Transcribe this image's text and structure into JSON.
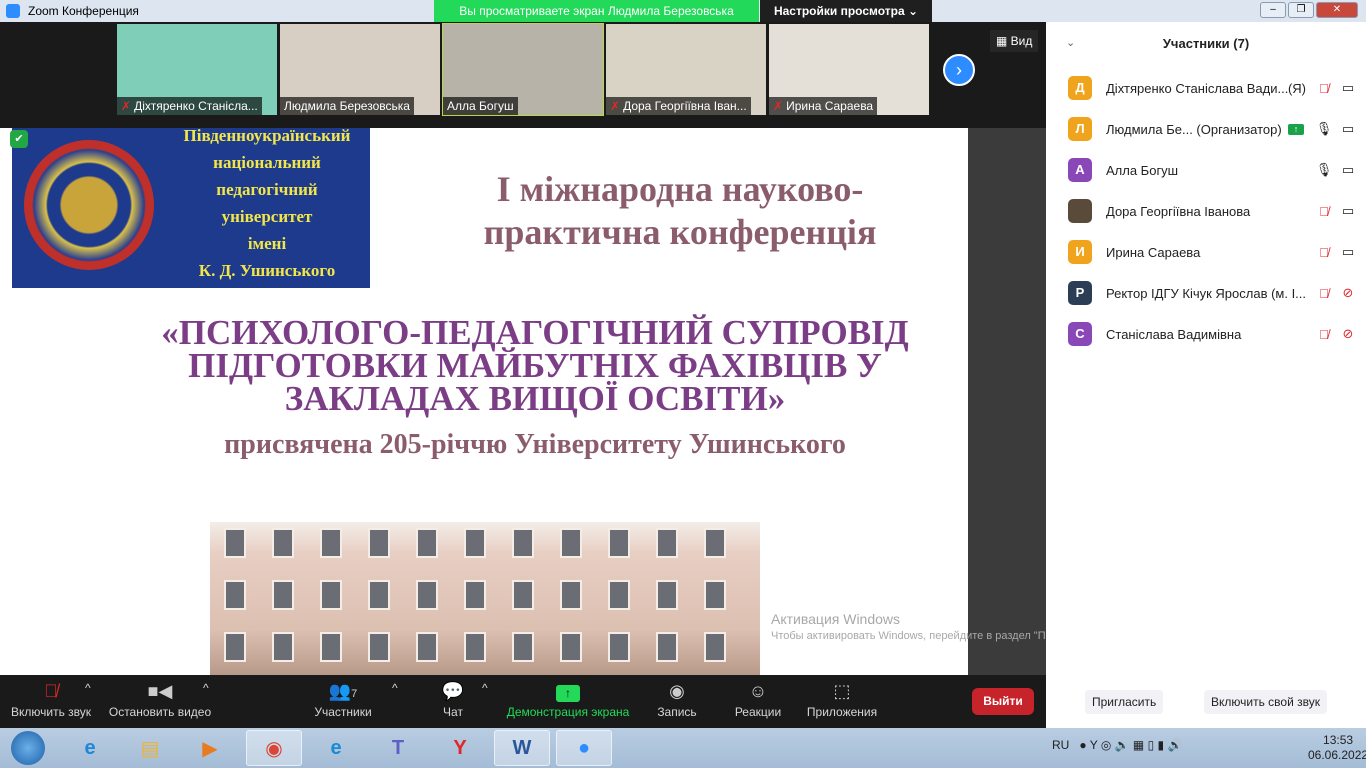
{
  "window": {
    "title": "Zoom Конференция"
  },
  "banner": {
    "sharing": "Вы просматриваете экран Людмила Березовська",
    "view_options": "Настройки просмотра ⌄"
  },
  "gallery": {
    "tiles": [
      {
        "name": "Діхтяренко Станісла...",
        "muted": true,
        "color": "#7fcfb8"
      },
      {
        "name": "Людмила Березовська",
        "muted": false,
        "color": "#d8cfc4"
      },
      {
        "name": "Алла Богуш",
        "muted": false,
        "color": "#b8b3a8",
        "active": true
      },
      {
        "name": "Дора Георгіївна Іван...",
        "muted": true,
        "color": "#d9d3c6"
      },
      {
        "name": "Ирина Сараева",
        "muted": true,
        "color": "#e4e0d8"
      }
    ],
    "view_label": "Вид"
  },
  "slide": {
    "logo_text": [
      "Південноукраїнський",
      "національний",
      "педагогічний",
      "університет",
      "імені",
      "К. Д. Ушинського"
    ],
    "title1": "І міжнародна науково-практична конференція",
    "title2": "«ПСИХОЛОГО-ПЕДАГОГІЧНИЙ СУПРОВІД ПІДГОТОВКИ МАЙБУТНІХ ФАХІВЦІВ У ЗАКЛАДАХ ВИЩОЇ ОСВІТИ»",
    "title3": "присвячена 205-річчю Університету Ушинського"
  },
  "activation": {
    "title": "Активация Windows",
    "text": "Чтобы активировать Windows, перейдите в раздел \"Параметры\"."
  },
  "participants": {
    "title": "Участники (7)",
    "list": [
      {
        "initial": "Д",
        "color": "#f0a31c",
        "name": "Діхтяренко Станіслава Вади...",
        "tag": "(Я)",
        "mic": "muted",
        "cam": "on"
      },
      {
        "initial": "Л",
        "color": "#f0a31c",
        "name": "Людмила Бе... (Организатор)",
        "mic": "on",
        "cam": "on",
        "sharing": true
      },
      {
        "initial": "А",
        "color": "#8a47b8",
        "name": "Алла Богуш",
        "mic": "on",
        "cam": "on"
      },
      {
        "initial": "",
        "color": "#5a4a3a",
        "name": "Дора Георгіївна Іванова",
        "mic": "muted",
        "cam": "on"
      },
      {
        "initial": "И",
        "color": "#f0a31c",
        "name": "Ирина Сараева",
        "mic": "muted",
        "cam": "on"
      },
      {
        "initial": "Р",
        "color": "#2b3e55",
        "name": "Ректор ІДГУ Кічук Ярослав (м. І...",
        "mic": "muted",
        "cam": "off"
      },
      {
        "initial": "С",
        "color": "#8a47b8",
        "name": "Станіслава Вадимівна",
        "mic": "muted",
        "cam": "off"
      }
    ],
    "invite": "Пригласить",
    "unmute_me": "Включить свой звук"
  },
  "toolbar": {
    "unmute": "Включить звук",
    "stop_video": "Остановить видео",
    "participants": "Участники",
    "participants_count": "7",
    "chat": "Чат",
    "share": "Демонстрация экрана",
    "record": "Запись",
    "reactions": "Реакции",
    "apps": "Приложения",
    "leave": "Выйти",
    "share_color": "#23d959"
  },
  "taskbar": {
    "lang": "RU",
    "time": "13:53",
    "date": "06.06.2022"
  }
}
